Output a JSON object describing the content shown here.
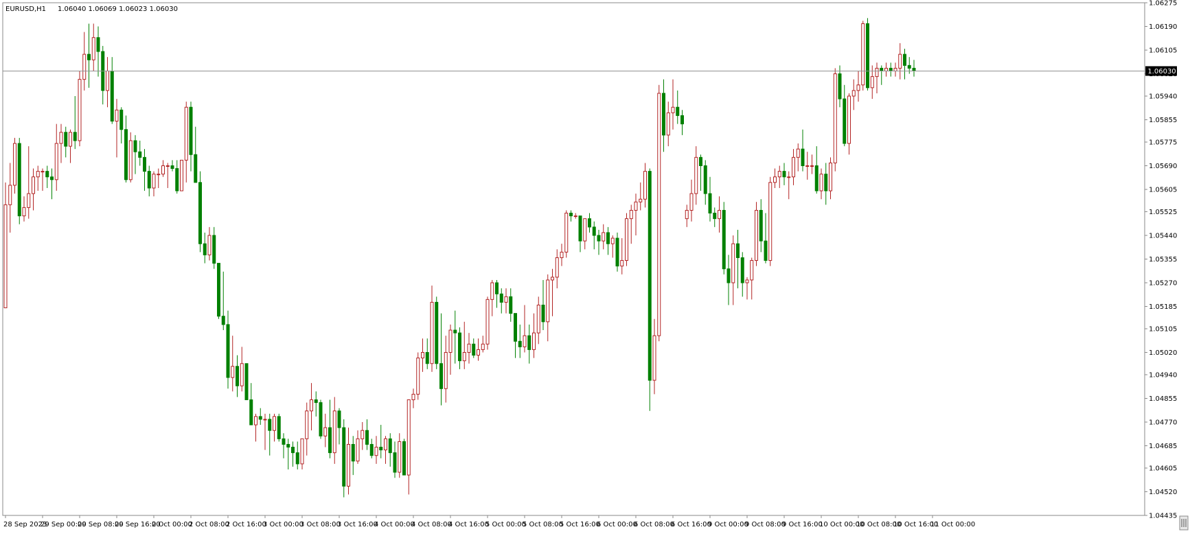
{
  "header": {
    "symbol": "EURUSD,H1",
    "ohlc": "1.06040 1.06069 1.06023 1.06030"
  },
  "colors": {
    "bull": "#b22222",
    "bear": "#008000",
    "background": "#ffffff",
    "frame": "#888888",
    "price_line": "#909090",
    "price_label_bg": "#000000",
    "price_label_text": "#ffffff"
  },
  "chart_data": {
    "type": "candlestick",
    "symbol": "EURUSD",
    "timeframe": "H1",
    "current_price": 1.0603,
    "current_price_label": "1.06030",
    "ylim": [
      1.04435,
      1.06275
    ],
    "y_ticks": [
      "1.06275",
      "1.06190",
      "1.06105",
      "1.06020",
      "1.05940",
      "1.05855",
      "1.05775",
      "1.05690",
      "1.05605",
      "1.05525",
      "1.05440",
      "1.05355",
      "1.05270",
      "1.05185",
      "1.05105",
      "1.05020",
      "1.04940",
      "1.04855",
      "1.04770",
      "1.04685",
      "1.04605",
      "1.04520",
      "1.04435"
    ],
    "x_ticks": [
      {
        "label": "28 Sep 2023",
        "bar": 0
      },
      {
        "label": "29 Sep 00:00",
        "bar": 8
      },
      {
        "label": "29 Sep 08:00",
        "bar": 16
      },
      {
        "label": "29 Sep 16:00",
        "bar": 24
      },
      {
        "label": "2 Oct 00:00",
        "bar": 32
      },
      {
        "label": "2 Oct 08:00",
        "bar": 40
      },
      {
        "label": "2 Oct 16:00",
        "bar": 48
      },
      {
        "label": "3 Oct 00:00",
        "bar": 56
      },
      {
        "label": "3 Oct 08:00",
        "bar": 64
      },
      {
        "label": "3 Oct 16:00",
        "bar": 72
      },
      {
        "label": "4 Oct 00:00",
        "bar": 80
      },
      {
        "label": "4 Oct 08:00",
        "bar": 88
      },
      {
        "label": "4 Oct 16:00",
        "bar": 96
      },
      {
        "label": "5 Oct 00:00",
        "bar": 104
      },
      {
        "label": "5 Oct 08:00",
        "bar": 112
      },
      {
        "label": "5 Oct 16:00",
        "bar": 120
      },
      {
        "label": "6 Oct 00:00",
        "bar": 128
      },
      {
        "label": "6 Oct 08:00",
        "bar": 136
      },
      {
        "label": "6 Oct 16:00",
        "bar": 144
      },
      {
        "label": "9 Oct 00:00",
        "bar": 152
      },
      {
        "label": "9 Oct 08:00",
        "bar": 160
      },
      {
        "label": "9 Oct 16:00",
        "bar": 168
      },
      {
        "label": "10 Oct 00:00",
        "bar": 176
      },
      {
        "label": "10 Oct 08:00",
        "bar": 184
      },
      {
        "label": "10 Oct 16:00",
        "bar": 192
      },
      {
        "label": "11 Oct 00:00",
        "bar": 200
      }
    ],
    "ohlc_columns": [
      "open",
      "high",
      "low",
      "close"
    ],
    "candles": [
      [
        1.0518,
        1.0563,
        1.0518,
        1.0555
      ],
      [
        1.0555,
        1.057,
        1.0545,
        1.0562
      ],
      [
        1.0562,
        1.0579,
        1.0559,
        1.0577
      ],
      [
        1.0577,
        1.0579,
        1.0548,
        1.0551
      ],
      [
        1.0551,
        1.0558,
        1.0549,
        1.0554
      ],
      [
        1.0554,
        1.0576,
        1.055,
        1.0559
      ],
      [
        1.0559,
        1.0568,
        1.0553,
        1.0565
      ],
      [
        1.0565,
        1.0569,
        1.056,
        1.0567
      ],
      [
        1.0567,
        1.0568,
        1.056,
        1.0567
      ],
      [
        1.0567,
        1.0569,
        1.0561,
        1.0565
      ],
      [
        1.0565,
        1.0568,
        1.0557,
        1.0564
      ],
      [
        1.0564,
        1.0584,
        1.056,
        1.0577
      ],
      [
        1.0577,
        1.0584,
        1.057,
        1.0581
      ],
      [
        1.0581,
        1.0583,
        1.0572,
        1.0576
      ],
      [
        1.0576,
        1.0582,
        1.057,
        1.0581
      ],
      [
        1.0581,
        1.0594,
        1.0575,
        1.0578
      ],
      [
        1.0578,
        1.0603,
        1.0576,
        1.06
      ],
      [
        1.06,
        1.0617,
        1.0596,
        1.0609
      ],
      [
        1.0609,
        1.062,
        1.0597,
        1.0607
      ],
      [
        1.0607,
        1.062,
        1.0603,
        1.0615
      ],
      [
        1.0615,
        1.0619,
        1.0601,
        1.061
      ],
      [
        1.061,
        1.0612,
        1.0591,
        1.0596
      ],
      [
        1.0596,
        1.0608,
        1.059,
        1.0603
      ],
      [
        1.0603,
        1.0608,
        1.0584,
        1.0585
      ],
      [
        1.0585,
        1.0593,
        1.0572,
        1.0589
      ],
      [
        1.0589,
        1.059,
        1.0577,
        1.0582
      ],
      [
        1.0582,
        1.0587,
        1.0563,
        1.0564
      ],
      [
        1.0564,
        1.0581,
        1.0563,
        1.0578
      ],
      [
        1.0578,
        1.058,
        1.0566,
        1.0574
      ],
      [
        1.0574,
        1.0578,
        1.0569,
        1.0572
      ],
      [
        1.0572,
        1.0575,
        1.056,
        1.0567
      ],
      [
        1.0567,
        1.0569,
        1.0558,
        1.0561
      ],
      [
        1.0561,
        1.0567,
        1.0558,
        1.0566
      ],
      [
        1.0566,
        1.0568,
        1.0561,
        1.0566
      ],
      [
        1.0566,
        1.0571,
        1.0565,
        1.0569
      ],
      [
        1.0569,
        1.057,
        1.0561,
        1.0569
      ],
      [
        1.0569,
        1.0571,
        1.0567,
        1.0568
      ],
      [
        1.0568,
        1.0571,
        1.0559,
        1.056
      ],
      [
        1.056,
        1.0571,
        1.056,
        1.0571
      ],
      [
        1.0571,
        1.0592,
        1.0563,
        1.059
      ],
      [
        1.059,
        1.0592,
        1.0567,
        1.0573
      ],
      [
        1.0573,
        1.0583,
        1.0563,
        1.0563
      ],
      [
        1.0563,
        1.0567,
        1.0538,
        1.0541
      ],
      [
        1.0541,
        1.0545,
        1.0534,
        1.0537
      ],
      [
        1.0537,
        1.0547,
        1.0535,
        1.0544
      ],
      [
        1.0544,
        1.0547,
        1.0532,
        1.0534
      ],
      [
        1.0534,
        1.0534,
        1.0514,
        1.0515
      ],
      [
        1.0515,
        1.0531,
        1.051,
        1.0512
      ],
      [
        1.0512,
        1.0517,
        1.0489,
        1.0493
      ],
      [
        1.0493,
        1.0508,
        1.0488,
        1.0497
      ],
      [
        1.0497,
        1.0501,
        1.0486,
        1.049
      ],
      [
        1.049,
        1.0504,
        1.0488,
        1.0498
      ],
      [
        1.0498,
        1.0498,
        1.0485,
        1.0485
      ],
      [
        1.0485,
        1.0491,
        1.0476,
        1.0476
      ],
      [
        1.0476,
        1.048,
        1.047,
        1.0479
      ],
      [
        1.0479,
        1.0482,
        1.0476,
        1.0478
      ],
      [
        1.0478,
        1.048,
        1.0467,
        1.0478
      ],
      [
        1.0478,
        1.048,
        1.0465,
        1.0474
      ],
      [
        1.0474,
        1.048,
        1.047,
        1.0479
      ],
      [
        1.0479,
        1.048,
        1.047,
        1.0471
      ],
      [
        1.0471,
        1.0473,
        1.0464,
        1.0469
      ],
      [
        1.0469,
        1.0471,
        1.046,
        1.0468
      ],
      [
        1.0468,
        1.047,
        1.0461,
        1.0466
      ],
      [
        1.0466,
        1.047,
        1.046,
        1.0462
      ],
      [
        1.0462,
        1.0471,
        1.046,
        1.0471
      ],
      [
        1.0471,
        1.0484,
        1.0465,
        1.0481
      ],
      [
        1.0481,
        1.0491,
        1.0474,
        1.0485
      ],
      [
        1.0485,
        1.0488,
        1.0479,
        1.0484
      ],
      [
        1.0484,
        1.0485,
        1.0471,
        1.0472
      ],
      [
        1.0472,
        1.048,
        1.0468,
        1.0475
      ],
      [
        1.0475,
        1.0485,
        1.0464,
        1.0466
      ],
      [
        1.0466,
        1.0486,
        1.0462,
        1.0481
      ],
      [
        1.0481,
        1.0482,
        1.0469,
        1.0475
      ],
      [
        1.0475,
        1.0478,
        1.045,
        1.0454
      ],
      [
        1.0454,
        1.0475,
        1.0451,
        1.0469
      ],
      [
        1.0469,
        1.0472,
        1.0458,
        1.0463
      ],
      [
        1.0463,
        1.0474,
        1.0462,
        1.0471
      ],
      [
        1.0471,
        1.0477,
        1.0467,
        1.0474
      ],
      [
        1.0474,
        1.0478,
        1.0467,
        1.0469
      ],
      [
        1.0469,
        1.0471,
        1.0464,
        1.0465
      ],
      [
        1.0465,
        1.0472,
        1.0462,
        1.0468
      ],
      [
        1.0468,
        1.0476,
        1.0464,
        1.0467
      ],
      [
        1.0467,
        1.0472,
        1.0462,
        1.0471
      ],
      [
        1.0471,
        1.0473,
        1.0461,
        1.0466
      ],
      [
        1.0466,
        1.047,
        1.0457,
        1.0459
      ],
      [
        1.0459,
        1.0473,
        1.0457,
        1.047
      ],
      [
        1.047,
        1.0471,
        1.046,
        1.0458
      ],
      [
        1.0458,
        1.0485,
        1.0451,
        1.0485
      ],
      [
        1.0485,
        1.0489,
        1.0482,
        1.0487
      ],
      [
        1.0487,
        1.0502,
        1.0485,
        1.05
      ],
      [
        1.05,
        1.0507,
        1.0495,
        1.0502
      ],
      [
        1.0502,
        1.0507,
        1.0496,
        1.0498
      ],
      [
        1.0498,
        1.0526,
        1.0495,
        1.052
      ],
      [
        1.052,
        1.0522,
        1.0496,
        1.0498
      ],
      [
        1.0498,
        1.0516,
        1.0483,
        1.0489
      ],
      [
        1.0489,
        1.0508,
        1.0484,
        1.0502
      ],
      [
        1.0502,
        1.0512,
        1.0494,
        1.051
      ],
      [
        1.051,
        1.0517,
        1.0498,
        1.0509
      ],
      [
        1.0509,
        1.0511,
        1.0496,
        1.0499
      ],
      [
        1.0499,
        1.0513,
        1.0496,
        1.0502
      ],
      [
        1.0502,
        1.0509,
        1.0498,
        1.0505
      ],
      [
        1.0505,
        1.0507,
        1.05,
        1.0501
      ],
      [
        1.0501,
        1.0507,
        1.0499,
        1.0503
      ],
      [
        1.0503,
        1.0508,
        1.0502,
        1.0505
      ],
      [
        1.0505,
        1.0522,
        1.0503,
        1.0521
      ],
      [
        1.0521,
        1.0528,
        1.0515,
        1.0527
      ],
      [
        1.0527,
        1.0528,
        1.0518,
        1.0523
      ],
      [
        1.0523,
        1.0525,
        1.0516,
        1.052
      ],
      [
        1.052,
        1.0525,
        1.0516,
        1.0522
      ],
      [
        1.0522,
        1.0525,
        1.0513,
        1.0516
      ],
      [
        1.0516,
        1.0516,
        1.05,
        1.0506
      ],
      [
        1.0506,
        1.0512,
        1.05,
        1.0504
      ],
      [
        1.0504,
        1.0519,
        1.0502,
        1.0508
      ],
      [
        1.0508,
        1.0512,
        1.0498,
        1.0503
      ],
      [
        1.0503,
        1.0516,
        1.05,
        1.0509
      ],
      [
        1.0509,
        1.0522,
        1.0505,
        1.0519
      ],
      [
        1.0519,
        1.0528,
        1.051,
        1.0513
      ],
      [
        1.0513,
        1.053,
        1.0506,
        1.0528
      ],
      [
        1.0528,
        1.0532,
        1.0515,
        1.0529
      ],
      [
        1.0529,
        1.0539,
        1.0525,
        1.0536
      ],
      [
        1.0536,
        1.0541,
        1.0533,
        1.0538
      ],
      [
        1.0538,
        1.0553,
        1.0536,
        1.0552
      ],
      [
        1.0552,
        1.0553,
        1.0549,
        1.0551
      ],
      [
        1.0551,
        1.0552,
        1.055,
        1.0551
      ],
      [
        1.0551,
        1.055,
        1.0538,
        1.0542
      ],
      [
        1.0542,
        1.055,
        1.0539,
        1.055
      ],
      [
        1.055,
        1.0552,
        1.0545,
        1.0547
      ],
      [
        1.0547,
        1.0549,
        1.0539,
        1.0544
      ],
      [
        1.0544,
        1.0546,
        1.0537,
        1.0542
      ],
      [
        1.0542,
        1.0548,
        1.0539,
        1.0545
      ],
      [
        1.0545,
        1.0547,
        1.0537,
        1.0541
      ],
      [
        1.0541,
        1.0544,
        1.0536,
        1.0543
      ],
      [
        1.0543,
        1.0545,
        1.0531,
        1.0533
      ],
      [
        1.0533,
        1.0543,
        1.053,
        1.0535
      ],
      [
        1.0535,
        1.0552,
        1.0533,
        1.055
      ],
      [
        1.055,
        1.0555,
        1.0541,
        1.0553
      ],
      [
        1.0553,
        1.0559,
        1.0544,
        1.0556
      ],
      [
        1.0556,
        1.0563,
        1.0553,
        1.0557
      ],
      [
        1.0557,
        1.057,
        1.0554,
        1.0567
      ],
      [
        1.0567,
        1.0568,
        1.0481,
        1.0492
      ],
      [
        1.0492,
        1.0514,
        1.0487,
        1.0508
      ],
      [
        1.0508,
        1.0598,
        1.0506,
        1.0595
      ],
      [
        1.0595,
        1.06,
        1.0574,
        1.058
      ],
      [
        1.058,
        1.0592,
        1.0576,
        1.0588
      ],
      [
        1.0588,
        1.06,
        1.0582,
        1.059
      ],
      [
        1.059,
        1.0596,
        1.0584,
        1.0587
      ],
      [
        1.0587,
        1.0589,
        1.058,
        1.0584
      ],
      [
        1.055,
        1.0555,
        1.0547,
        1.0553
      ],
      [
        1.0553,
        1.0564,
        1.0549,
        1.0559
      ],
      [
        1.0559,
        1.0576,
        1.0555,
        1.0572
      ],
      [
        1.0572,
        1.0573,
        1.056,
        1.0569
      ],
      [
        1.0569,
        1.0571,
        1.0555,
        1.0559
      ],
      [
        1.0559,
        1.0565,
        1.0549,
        1.0552
      ],
      [
        1.0552,
        1.0554,
        1.0547,
        1.055
      ],
      [
        1.055,
        1.0558,
        1.0545,
        1.0553
      ],
      [
        1.0553,
        1.0556,
        1.053,
        1.0532
      ],
      [
        1.0532,
        1.0537,
        1.0519,
        1.0527
      ],
      [
        1.0527,
        1.0544,
        1.0519,
        1.0541
      ],
      [
        1.0541,
        1.0546,
        1.0525,
        1.0536
      ],
      [
        1.0536,
        1.0538,
        1.0522,
        1.0527
      ],
      [
        1.0527,
        1.0529,
        1.0521,
        1.0528
      ],
      [
        1.0528,
        1.0536,
        1.0521,
        1.0535
      ],
      [
        1.0535,
        1.0556,
        1.0533,
        1.0553
      ],
      [
        1.0553,
        1.0557,
        1.0538,
        1.0542
      ],
      [
        1.0542,
        1.0552,
        1.0534,
        1.0535
      ],
      [
        1.0535,
        1.0565,
        1.0533,
        1.0563
      ],
      [
        1.0563,
        1.0568,
        1.0561,
        1.0565
      ],
      [
        1.0565,
        1.0569,
        1.0561,
        1.0567
      ],
      [
        1.0567,
        1.057,
        1.0562,
        1.0565
      ],
      [
        1.0565,
        1.0567,
        1.0557,
        1.0565
      ],
      [
        1.0565,
        1.0575,
        1.0562,
        1.0572
      ],
      [
        1.0572,
        1.0577,
        1.0567,
        1.0575
      ],
      [
        1.0575,
        1.0582,
        1.0567,
        1.0569
      ],
      [
        1.0569,
        1.0574,
        1.0564,
        1.0569
      ],
      [
        1.0569,
        1.0573,
        1.0566,
        1.0569
      ],
      [
        1.0569,
        1.0576,
        1.0559,
        1.056
      ],
      [
        1.056,
        1.0568,
        1.0557,
        1.0566
      ],
      [
        1.0566,
        1.057,
        1.0555,
        1.056
      ],
      [
        1.056,
        1.0572,
        1.0557,
        1.057
      ],
      [
        1.057,
        1.0604,
        1.0567,
        1.0602
      ],
      [
        1.0602,
        1.0605,
        1.059,
        1.0593
      ],
      [
        1.0593,
        1.0598,
        1.0576,
        1.0577
      ],
      [
        1.0577,
        1.0595,
        1.0573,
        1.0594
      ],
      [
        1.0594,
        1.06,
        1.0589,
        1.0596
      ],
      [
        1.0596,
        1.0603,
        1.0592,
        1.0598
      ],
      [
        1.0598,
        1.0621,
        1.0596,
        1.062
      ],
      [
        1.062,
        1.0622,
        1.0596,
        1.0597
      ],
      [
        1.0597,
        1.0605,
        1.0593,
        1.0601
      ],
      [
        1.0601,
        1.0606,
        1.0595,
        1.0604
      ],
      [
        1.0604,
        1.0605,
        1.0598,
        1.0603
      ],
      [
        1.0603,
        1.0606,
        1.0601,
        1.0604
      ],
      [
        1.0604,
        1.0606,
        1.0601,
        1.0603
      ],
      [
        1.0603,
        1.0606,
        1.0601,
        1.0604
      ],
      [
        1.0604,
        1.0613,
        1.06,
        1.0609
      ],
      [
        1.0609,
        1.0611,
        1.06,
        1.0605
      ],
      [
        1.0605,
        1.0608,
        1.0602,
        1.0604
      ],
      [
        1.0604,
        1.0607,
        1.0601,
        1.0603
      ]
    ],
    "gridlines": false,
    "legend": "none"
  }
}
